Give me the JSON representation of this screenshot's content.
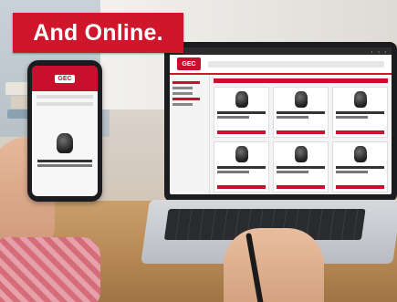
{
  "banner": {
    "text": "And Online.",
    "bg": "#d0162a",
    "fg": "#ffffff"
  },
  "site": {
    "brand_logo": "GEC",
    "accent": "#c8102e"
  }
}
